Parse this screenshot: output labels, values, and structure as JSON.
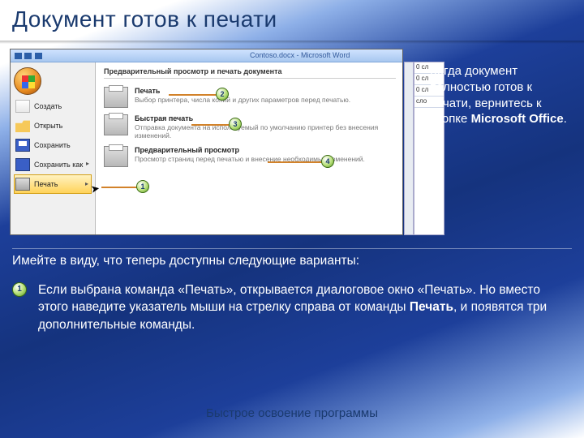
{
  "slide": {
    "title": "Документ готов к печати",
    "caption_pre": "Когда документ полностью готов к печати, вернитесь к кнопке ",
    "caption_bold": "Microsoft Office",
    "caption_post": ".",
    "subhead": "Имейте в виду, что теперь доступны следующие варианты:",
    "body_pre": "Если выбрана команда «Печать»‎, открывается диалоговое окно «Печать». Но вместо этого наведите указатель мыши на стрелку справа от команды ",
    "body_bold": "Печать",
    "body_post": ", и появятся три дополнительные команды.",
    "footer": "Быстрое освоение программы",
    "bullet_num": "1"
  },
  "window": {
    "chrome_title": "Contoso.docx - Microsoft Word",
    "doctabs": [
      "0 сл",
      "0 сл",
      "0 сл",
      "сло"
    ]
  },
  "leftmenu": [
    {
      "label": "Создать"
    },
    {
      "label": "Открыть"
    },
    {
      "label": "Сохранить"
    },
    {
      "label": "Сохранить как",
      "arrow": "▸"
    },
    {
      "label": "Печать",
      "arrow": "▸",
      "selected": true
    }
  ],
  "rightpanel": {
    "title": "Предварительный просмотр и печать документа",
    "items": [
      {
        "name": "Печать",
        "desc": "Выбор принтера, числа копий и других параметров перед печатью."
      },
      {
        "name": "Быстрая печать",
        "desc": "Отправка документа на используемый по умолчанию принтер без внесения изменений."
      },
      {
        "name": "Предварительный просмотр",
        "desc": "Просмотр страниц перед печатью и внесение необходимых изменений."
      }
    ]
  },
  "callouts": {
    "c1": "1",
    "c2": "2",
    "c3": "3",
    "c4": "4"
  }
}
